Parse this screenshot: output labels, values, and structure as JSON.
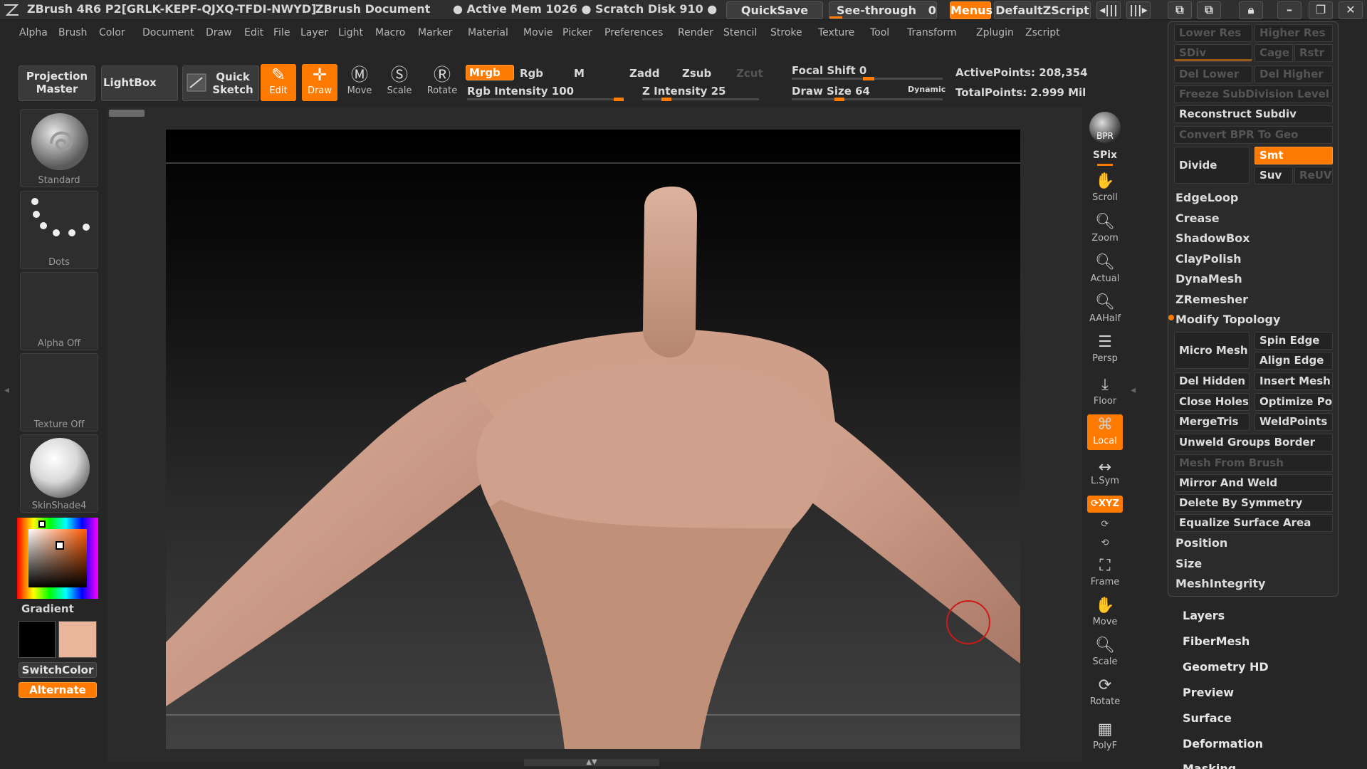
{
  "titlebar": {
    "app": "ZBrush 4R6 P2[GRLK-KEPF-QJXQ-TFDI-NWYD]",
    "document": "ZBrush Document",
    "active_mem": "Active Mem 1026",
    "scratch_disk": "Scratch Disk 910",
    "quicksave": "QuickSave",
    "see_through": "See-through",
    "see_through_value": "0",
    "menus": "Menus",
    "script": "DefaultZScript"
  },
  "menubar": [
    "Alpha",
    "Brush",
    "Color",
    "Document",
    "Draw",
    "Edit",
    "File",
    "Layer",
    "Light",
    "Macro",
    "Marker",
    "Material",
    "Movie",
    "Picker",
    "Preferences",
    "Render",
    "Stencil",
    "Stroke",
    "Texture",
    "Tool",
    "Transform",
    "Zplugin",
    "Zscript"
  ],
  "shelf": {
    "projection_master": [
      "Projection",
      "Master"
    ],
    "lightbox": "LightBox",
    "quick_sketch": [
      "Quick",
      "Sketch"
    ],
    "tools": [
      {
        "label": "Edit",
        "icon": "edit-icon",
        "active": true
      },
      {
        "label": "Draw",
        "icon": "draw-icon",
        "active": true
      },
      {
        "label": "Move",
        "icon": "move-icon",
        "active": false
      },
      {
        "label": "Scale",
        "icon": "scale-icon",
        "active": false
      },
      {
        "label": "Rotate",
        "icon": "rotate-icon",
        "active": false
      }
    ],
    "mrgb": "Mrgb",
    "rgb": "Rgb",
    "m": "M",
    "zadd": "Zadd",
    "zsub": "Zsub",
    "zcut": "Zcut",
    "rgb_intensity": "Rgb Intensity 100",
    "z_intensity": "Z Intensity 25",
    "focal_shift": "Focal Shift 0",
    "draw_size": "Draw Size 64",
    "dynamic": "Dynamic",
    "active_points": "ActivePoints: 208,354",
    "total_points": "TotalPoints: 2.999 Mil",
    "rgb_intensity_level": 1.0,
    "z_intensity_level": 0.25,
    "draw_size_level": 0.35
  },
  "left_shelf": {
    "brush": "Standard",
    "stroke": "Dots",
    "alpha": "Alpha Off",
    "texture": "Texture Off",
    "material": "SkinShade4",
    "gradient": "Gradient",
    "switch_color": "SwitchColor",
    "alternate": "Alternate",
    "main_color": "#000000",
    "secondary_color": "#e9b59b"
  },
  "right_dock": [
    {
      "label": "BPR",
      "icon": "bpr-sphere-icon"
    },
    {
      "label": "SPix",
      "icon": "spix-slider-icon"
    },
    {
      "label": "Scroll",
      "icon": "hand-scroll-icon"
    },
    {
      "label": "Zoom",
      "icon": "zoom-icon"
    },
    {
      "label": "Actual",
      "icon": "actual-zoom-icon"
    },
    {
      "label": "AAHalf",
      "icon": "aahalf-icon"
    },
    {
      "label": "Persp",
      "icon": "perspective-icon"
    },
    {
      "label": "Floor",
      "icon": "floor-icon"
    },
    {
      "label": "Local",
      "icon": "local-icon"
    },
    {
      "label": "L.Sym",
      "icon": "local-symmetry-icon"
    },
    {
      "label": "XYZ",
      "icon": "xyz-rotate-icon"
    },
    {
      "label": "Frame",
      "icon": "frame-icon"
    },
    {
      "label": "Move",
      "icon": "move-hand-icon"
    },
    {
      "label": "Scale",
      "icon": "scale-icon"
    },
    {
      "label": "Rotate",
      "icon": "rotate-icon"
    },
    {
      "label": "PolyF",
      "icon": "polyframe-icon"
    }
  ],
  "palette": {
    "lower_res": "Lower Res",
    "higher_res": "Higher Res",
    "sdiv": "SDiv",
    "cage": "Cage",
    "rstr": "Rstr",
    "del_lower": "Del Lower",
    "del_higher": "Del Higher",
    "freeze": "Freeze SubDivision Level",
    "reconstruct": "Reconstruct Subdiv",
    "convert_bpr": "Convert BPR To Geo",
    "divide": "Divide",
    "smt": "Smt",
    "suv": "Suv",
    "reuv": "ReUV",
    "items": [
      "EdgeLoop",
      "Crease",
      "ShadowBox",
      "ClayPolish",
      "DynaMesh",
      "ZRemesher"
    ],
    "modify_topology": "Modify Topology",
    "micro_mesh": "Micro Mesh",
    "spin_edge": "Spin Edge",
    "align_edge": "Align Edge",
    "del_hidden": "Del Hidden",
    "insert_mesh": "Insert Mesh",
    "close_holes": "Close Holes",
    "optimize": "Optimize Po",
    "merge_tris": "MergeTris",
    "weld_points": "WeldPoints",
    "unweld": "Unweld Groups Border",
    "mesh_from_brush": "Mesh From Brush",
    "mirror_weld": "Mirror And Weld",
    "delete_sym": "Delete By Symmetry",
    "equalize": "Equalize Surface Area",
    "items2": [
      "Position",
      "Size",
      "MeshIntegrity"
    ],
    "subpalettes": [
      "Layers",
      "FiberMesh",
      "Geometry HD",
      "Preview",
      "Surface",
      "Deformation",
      "Masking"
    ]
  }
}
